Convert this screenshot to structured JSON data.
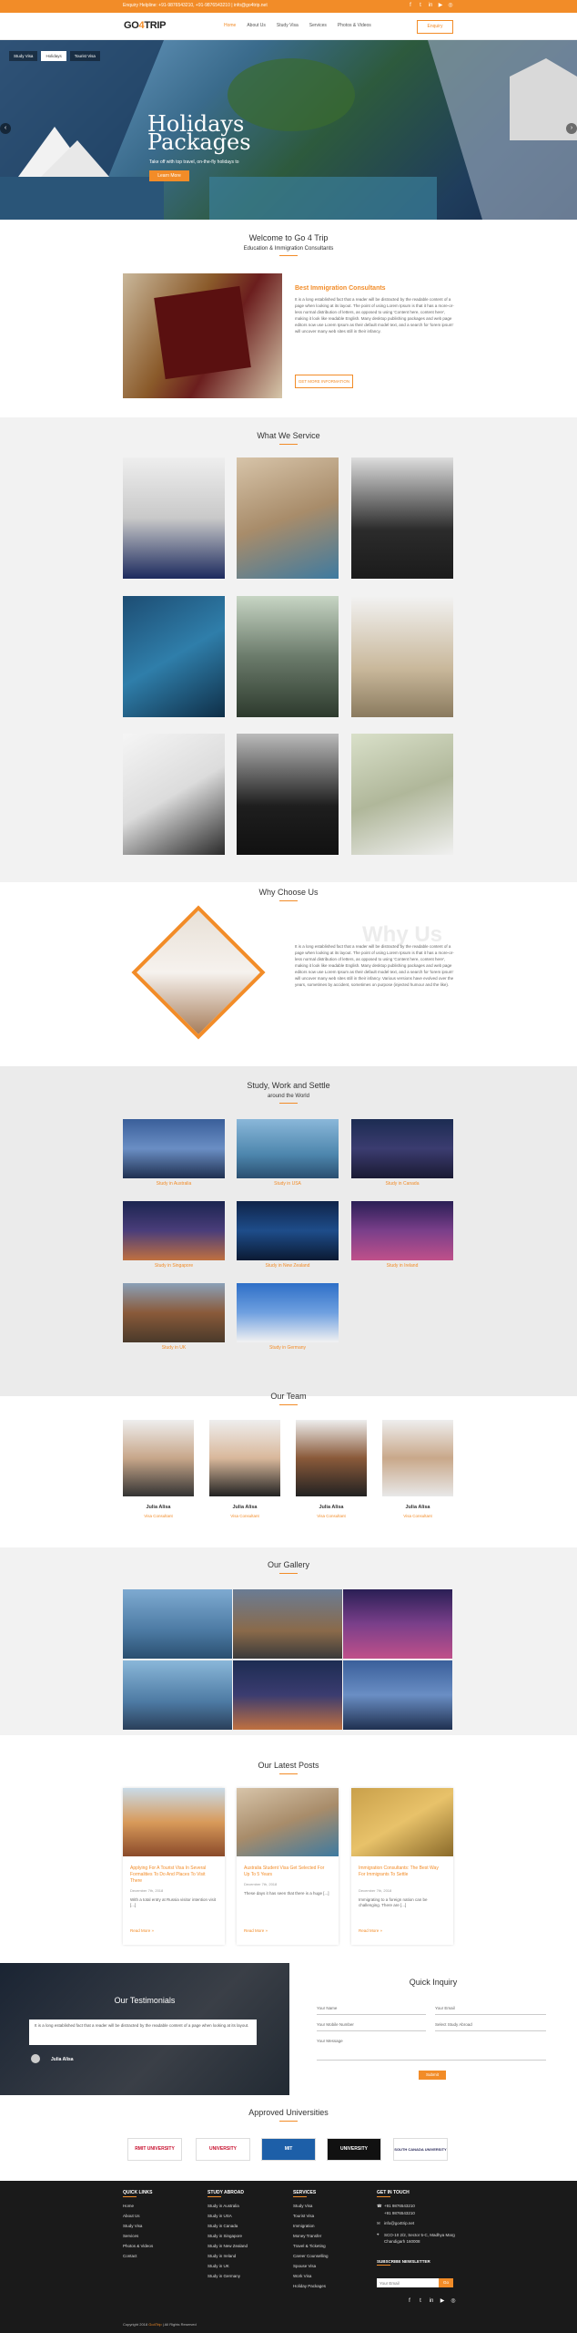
{
  "topbar": {
    "contact": "Enquiry Helpline: +91-9876543210, +91-9876543210 | info@go4trip.net",
    "icons": [
      "facebook-icon",
      "twitter-icon",
      "linkedin-icon",
      "youtube-icon",
      "instagram-icon"
    ]
  },
  "header": {
    "logo_text": "GO",
    "logo_accent": "4",
    "logo_rest": "TRIP",
    "nav": [
      "Home",
      "About Us",
      "Study Visa",
      "Services",
      "Photos & Videos"
    ],
    "enquiry": "Enquiry"
  },
  "hero": {
    "tabs": [
      "Study Visa",
      "Holidays",
      "Tourist Visa"
    ],
    "title_line1": "Holidays",
    "title_line2": "Packages",
    "subtitle": "Take off with top travel, on-the-fly holidays to",
    "button": "Learn More"
  },
  "welcome": {
    "title": "Welcome to Go 4 Trip",
    "subtitle": "Education & Immigration Consultants",
    "heading": "Best Immigration Consultants",
    "text": "It is a long established fact that a reader will be distracted by the readable content of a page when looking at its layout. The point of using Lorem Ipsum is that it has a more-or-less normal distribution of letters, as opposed to using 'Content here, content here', making it look like readable English. Many desktop publishing packages and web page editors now use Lorem Ipsum as their default model text, and a search for 'lorem ipsum' will uncover many web sites still in their infancy.",
    "button": "GET MORE INFORMATION"
  },
  "services": {
    "title": "What We Service"
  },
  "why": {
    "title": "Why Choose Us",
    "watermark": "Why Us",
    "text": "It is a long established fact that a reader will be distracted by the readable content of a page when looking at its layout. The point of using Lorem Ipsum is that it has a more-or-less normal distribution of letters, as opposed to using 'Content here, content here', making it look like readable English. Many desktop publishing packages and web page editors now use Lorem Ipsum as their default model text, and a search for 'lorem ipsum' will uncover many web sites still in their infancy. Various versions have evolved over the years, sometimes by accident, sometimes on purpose (injected humour and the like)."
  },
  "study": {
    "title": "Study, Work and Settle",
    "subtitle": "around the World",
    "items": [
      "Study in Australia",
      "Study in USA",
      "Study in Canada",
      "Study in Singapore",
      "Study in New Zealand",
      "Study in Ireland",
      "Study in UK",
      "Study in Germany"
    ]
  },
  "team": {
    "title": "Our Team",
    "members": [
      {
        "name": "Julia Alisa",
        "role": "Visa Consultant"
      },
      {
        "name": "Julia Alisa",
        "role": "Visa Consultant"
      },
      {
        "name": "Julia Alisa",
        "role": "Visa Consultant"
      },
      {
        "name": "Julia Alisa",
        "role": "Visa Consultant"
      }
    ]
  },
  "gallery": {
    "title": "Our Gallery"
  },
  "posts": {
    "title": "Our Latest Posts",
    "items": [
      {
        "title": "Applying For A Tourist Visa In Several Formalities To Do And Places To Visit There",
        "date": "December 7th, 2018",
        "excerpt": "With a total entry at Russia visitor intention visit [...]",
        "more": "Read More »"
      },
      {
        "title": "Australia Student Visa Get Selected For Up To 5 Years",
        "date": "December 7th, 2018",
        "excerpt": "These days it has seen that there is a huge [...]",
        "more": "Read More »"
      },
      {
        "title": "Immigration Consultants: The Best Way For Immigrants To Settle",
        "date": "December 7th, 2018",
        "excerpt": "Immigrating to a foreign nation can be challenging. There are [...]",
        "more": "Read More »"
      }
    ]
  },
  "testimonials": {
    "title": "Our Testimonials",
    "quote": "It is a long established fact that a reader will be distracted by the readable content of a page when looking at its layout.",
    "author": "Julia Alisa"
  },
  "quick": {
    "title": "Quick Inquiry",
    "fields": [
      "Your Name",
      "Your Email",
      "Your Mobile Number",
      "Select Study Abroad",
      "Your Message"
    ],
    "button": "Submit"
  },
  "universities": {
    "title": "Approved Universities",
    "logos": [
      "RMIT UNIVERSITY",
      "UNIVERSITY",
      "MIT",
      "UNIVERSITY",
      "SOUTH CANADA UNIVERSITY"
    ]
  },
  "footer": {
    "quick_links": {
      "title": "QUICK LINKS",
      "items": [
        "Home",
        "About Us",
        "Study Visa",
        "Services",
        "Photos & Videos",
        "Contact"
      ]
    },
    "study_abroad": {
      "title": "STUDY ABROAD",
      "items": [
        "Study in Australia",
        "Study in USA",
        "Study in Canada",
        "Study in Singapore",
        "Study in New Zealand",
        "Study in Ireland",
        "Study in UK",
        "Study in Germany"
      ]
    },
    "services": {
      "title": "SERVICES",
      "items": [
        "Study Visa",
        "Tourist Visa",
        "Immigration",
        "Money Transfer",
        "Travel & Ticketing",
        "Career Counselling",
        "Spouse Visa",
        "Work Visa",
        "Holiday Packages"
      ]
    },
    "touch": {
      "title": "GET IN TOUCH",
      "phone1": "+91 9876543210",
      "phone2": "+91 9876543210",
      "email": "info@go4trip.net",
      "address": "SCO-10 2/2, Sector 5-C, Madhya Marg Chandigarh 160008"
    },
    "subscribe": {
      "title": "SUBSCRIBE NEWSLETTER",
      "placeholder": "Your Email",
      "button": "Go"
    },
    "copyright_pre": "Copyright 2018",
    "copyright_brand": "Go4Trip",
    "copyright_post": "| All Rights Reserved"
  }
}
